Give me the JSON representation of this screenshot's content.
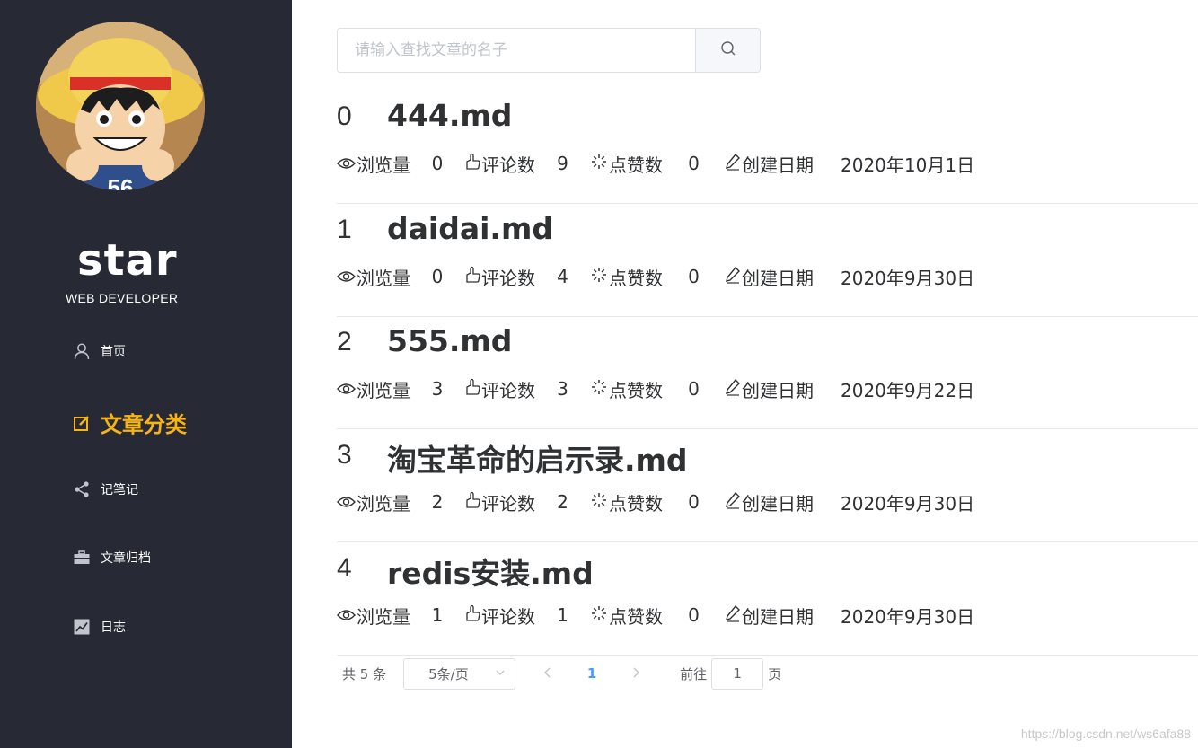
{
  "sidebar": {
    "name": "star",
    "subtitle": "WEB DEVELOPER",
    "avatar_icon": "cartoon-avatar",
    "avatar_jersey": "56",
    "nav": [
      {
        "label": "首页",
        "icon": "user-icon",
        "active": false
      },
      {
        "label": "文章分类",
        "icon": "edit-icon",
        "active": true
      },
      {
        "label": "记笔记",
        "icon": "share-icon",
        "active": false
      },
      {
        "label": "文章归档",
        "icon": "briefcase-icon",
        "active": false
      },
      {
        "label": "日志",
        "icon": "chart-icon",
        "active": false
      }
    ],
    "active_color": "#f7b417",
    "bg_color": "#272a34"
  },
  "search": {
    "placeholder": "请输入查找文章的名子",
    "value": ""
  },
  "meta_labels": {
    "views": "浏览量",
    "comments": "评论数",
    "likes": "点赞数",
    "created": "创建日期"
  },
  "articles": [
    {
      "index": "0",
      "title": "444.md",
      "views": "0",
      "comments": "9",
      "likes": "0",
      "date": "2020年10月1日"
    },
    {
      "index": "1",
      "title": "daidai.md",
      "views": "0",
      "comments": "4",
      "likes": "0",
      "date": "2020年9月30日"
    },
    {
      "index": "2",
      "title": "555.md",
      "views": "3",
      "comments": "3",
      "likes": "0",
      "date": "2020年9月22日"
    },
    {
      "index": "3",
      "title": "淘宝革命的启示录.md",
      "views": "2",
      "comments": "2",
      "likes": "0",
      "date": "2020年9月30日"
    },
    {
      "index": "4",
      "title": "redis安装.md",
      "views": "1",
      "comments": "1",
      "likes": "0",
      "date": "2020年9月30日"
    }
  ],
  "pagination": {
    "total_text": "共 5 条",
    "page_size": "5条/页",
    "current_page": "1",
    "goto_label": "前往",
    "goto_value": "1",
    "page_suffix": "页",
    "accent": "#409eff"
  },
  "watermark": "https://blog.csdn.net/ws6afa88"
}
